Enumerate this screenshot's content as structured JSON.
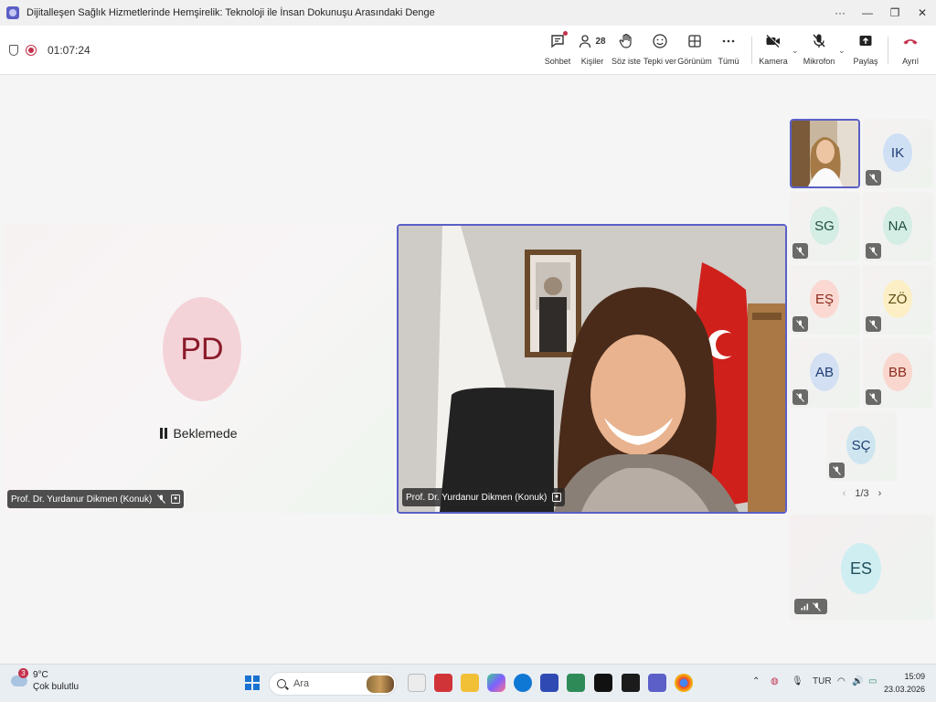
{
  "window": {
    "title": "Dijitalleşen Sağlık Hizmetlerinde Hemşirelik: Teknoloji ile İnsan Dokunuşu Arasındaki Denge",
    "controls": {
      "more": "···",
      "minimize": "—",
      "restore": "❐",
      "close": "✕"
    }
  },
  "toolbar": {
    "timer": "01:07:24",
    "participant_count": "28",
    "buttons": {
      "chat": "Sohbet",
      "people": "Kişiler",
      "raise_hand": "Söz iste",
      "react": "Tepki ver",
      "view": "Görünüm",
      "more": "Tümü",
      "camera": "Kamera",
      "mic": "Mikrofon",
      "share": "Paylaş",
      "leave": "Ayrıl"
    },
    "leave_color": "#c4314b",
    "accent_color": "#5b5fc7"
  },
  "stage": {
    "left_tile": {
      "initials": "PD",
      "status": "Beklemede",
      "name": "Prof. Dr. Yurdanur Dikmen (Konuk)"
    },
    "video_tile": {
      "name": "Prof. Dr. Yurdanur Dikmen (Konuk)"
    },
    "gallery": [
      {
        "initials": "",
        "video": true,
        "active": true
      },
      {
        "initials": "IK",
        "color": "#cfe0f5"
      },
      {
        "initials": "SG",
        "color": "#d4ede5"
      },
      {
        "initials": "NA",
        "color": "#d4ede5"
      },
      {
        "initials": "EŞ",
        "color": "#fbd9d2"
      },
      {
        "initials": "ZÖ",
        "color": "#fcefc5"
      },
      {
        "initials": "AB",
        "color": "#d3dff3"
      },
      {
        "initials": "BB",
        "color": "#f9d7cf"
      },
      {
        "initials": "SÇ",
        "color": "#cfe6f1"
      }
    ],
    "pager": {
      "label": "1/3",
      "prev": "‹",
      "next": "›"
    },
    "self_tile": {
      "initials": "ES"
    }
  },
  "taskbar": {
    "weather": {
      "badge": "3",
      "temp": "9°C",
      "desc": "Çok bulutlu"
    },
    "search_placeholder": "Ara",
    "lang": "TUR",
    "time": "15:09",
    "date": "23.03.2026"
  }
}
